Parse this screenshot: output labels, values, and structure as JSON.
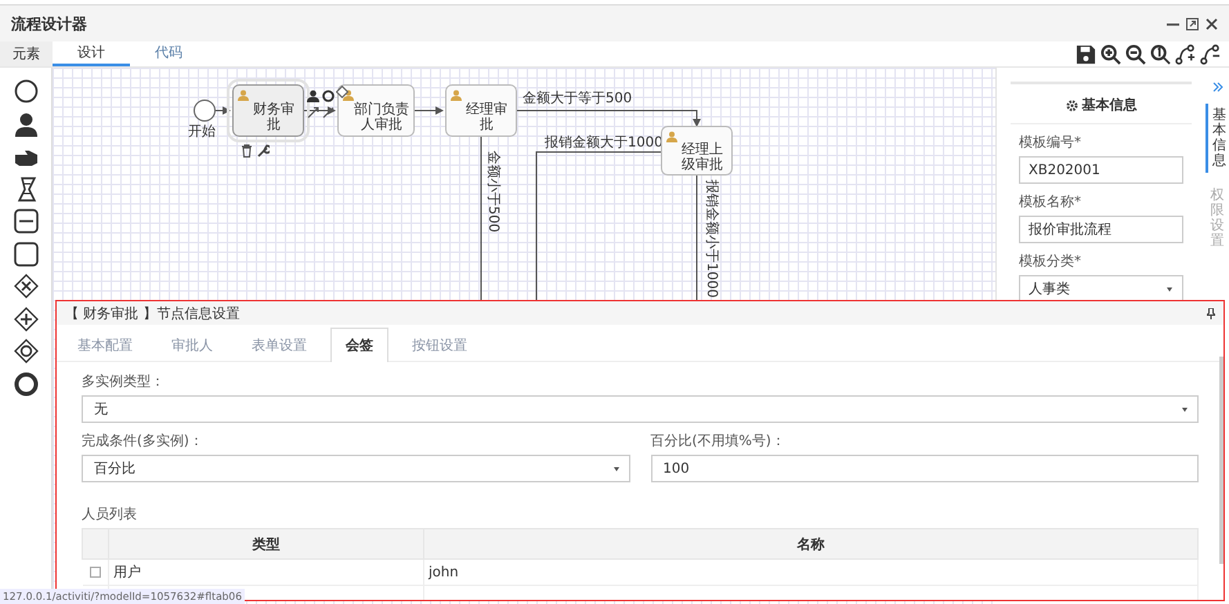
{
  "window": {
    "title": "流程设计器"
  },
  "palette": {
    "header": "元素"
  },
  "tabs": [
    {
      "label": "设计",
      "selected": true
    },
    {
      "label": "代码",
      "selected": false
    }
  ],
  "diagram": {
    "nodes": [
      {
        "kind": "start",
        "label": "开始",
        "selected": false
      },
      {
        "kind": "task",
        "label": "财务审批",
        "selected": true
      },
      {
        "kind": "task",
        "label": "部门负责人审批",
        "selected": false
      },
      {
        "kind": "task",
        "label": "经理审批",
        "selected": false
      },
      {
        "kind": "task",
        "label": "经理上级审批",
        "selected": false
      }
    ],
    "edges": [
      {
        "label": "金额大于等于500"
      },
      {
        "label": "金额小于500"
      },
      {
        "label": "报销金额大于1000"
      },
      {
        "label": "报销金额小于1000"
      }
    ]
  },
  "properties": {
    "title": "基本信息",
    "fields": [
      {
        "kind": "input",
        "label": "模板编号*",
        "value": "XB202001"
      },
      {
        "kind": "input",
        "label": "模板名称*",
        "value": "报价审批流程"
      },
      {
        "kind": "select",
        "label": "模板分类*",
        "value": "人事类"
      }
    ]
  },
  "side_tabs": [
    {
      "label": "基本信息",
      "selected": true
    },
    {
      "label": "权限设置",
      "selected": false
    }
  ],
  "node_panel": {
    "title": "【 财务审批 】节点信息设置",
    "tabs": [
      {
        "label": "基本配置",
        "selected": false
      },
      {
        "label": "审批人",
        "selected": false
      },
      {
        "label": "表单设置",
        "selected": false
      },
      {
        "label": "会签",
        "selected": true
      },
      {
        "label": "按钮设置",
        "selected": false
      }
    ],
    "multi_instance": {
      "label": "多实例类型：",
      "value": "无"
    },
    "completion": {
      "label": "完成条件(多实例)：",
      "value": "百分比"
    },
    "percent": {
      "label": "百分比(不用填%号)：",
      "value": "100"
    },
    "people": {
      "title": "人员列表",
      "columns": [
        "类型",
        "名称"
      ],
      "rows": [
        {
          "checked": false,
          "cells": [
            "用户",
            "john"
          ]
        }
      ]
    }
  },
  "status_bar": "127.0.0.1/activiti/?modelId=1057632#fltab06"
}
